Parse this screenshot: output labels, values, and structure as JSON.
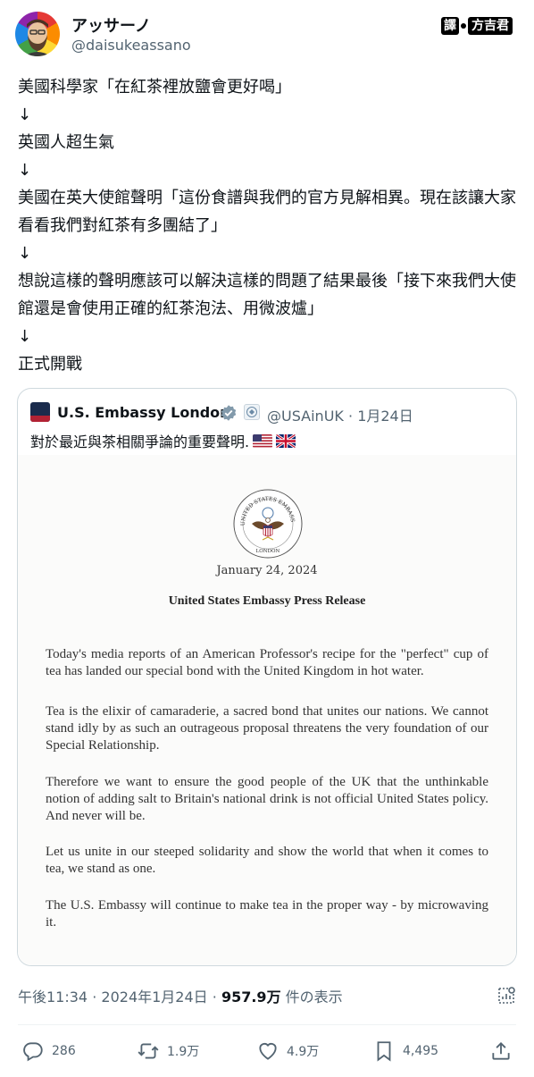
{
  "author": {
    "display_name": "アッサーノ",
    "handle": "@daisukeassano",
    "avatar": "bearded-man-rainbow-avatar"
  },
  "badge": {
    "part1": "譯",
    "part2": "方吉君"
  },
  "tweet": {
    "lines": [
      "美國科學家「在紅茶裡放鹽會更好喝」",
      "↓",
      "英國人超生氣",
      "↓",
      "美國在英大使館聲明「這份食譜與我們的官方見解相異。現在該讓大家看看我們對紅茶有多團結了」",
      "↓",
      "想說這樣的聲明應該可以解決這樣的問題了結果最後「接下來我們大使館還是會使用正確的紅茶泡法、用微波爐」",
      "↓",
      "正式開戰"
    ]
  },
  "quote": {
    "name": "U.S. Embassy London",
    "handle": "@USAinUK",
    "date": "1月24日",
    "separator": "·",
    "text": "對於最近與茶相關爭論的重要聲明.",
    "flags": [
      "us-flag-icon",
      "uk-flag-icon"
    ],
    "document": {
      "seal_text_top": "UNITED STATES EMBASSY",
      "seal_text_bottom": "LONDON",
      "date": "January 24, 2024",
      "title": "United States Embassy Press Release",
      "paragraphs": [
        "Today's media reports of an American Professor's recipe for the \"perfect\" cup of tea has landed our special bond with the United Kingdom in hot water.",
        "Tea is the elixir of camaraderie, a sacred bond that unites our nations. We cannot stand idly by as such an outrageous proposal threatens the very foundation of our Special Relationship.",
        "Therefore we want to ensure the good people of the UK that the unthinkable notion of adding salt to Britain's national drink is not official United States policy. And never will be.",
        "Let us unite in our steeped solidarity and show the world that when it comes to tea, we stand as one.",
        "The U.S. Embassy will continue to make tea in the proper way - by microwaving it."
      ]
    }
  },
  "meta": {
    "time": "午後11:34",
    "date": "2024年1月24日",
    "separator": "·",
    "views": "957.9万",
    "views_label": "件の表示"
  },
  "actions": {
    "replies": "286",
    "retweets": "1.9万",
    "likes": "4.9万",
    "bookmarks": "4,495"
  },
  "colors": {
    "text": "#0f1419",
    "secondary": "#536471",
    "border": "#cfd9de",
    "verified": "#829aab"
  }
}
